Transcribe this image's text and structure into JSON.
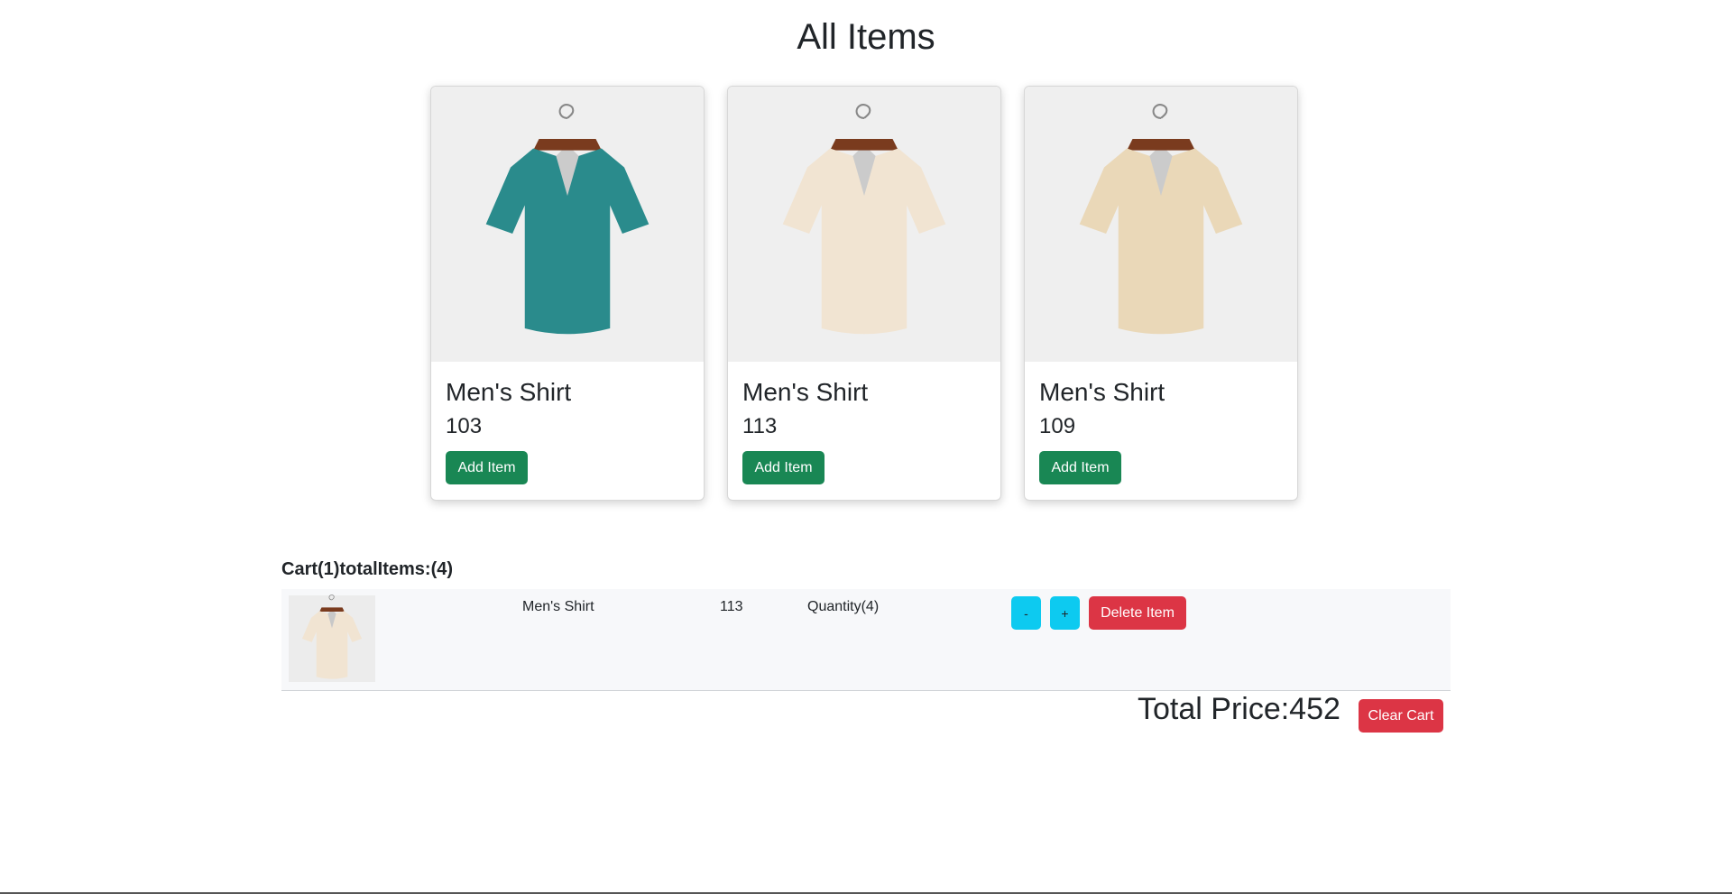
{
  "page": {
    "title": "All Items"
  },
  "products": [
    {
      "name": "Men's Shirt",
      "price": "103",
      "button": "Add Item",
      "pattern": "colorful-abstract"
    },
    {
      "name": "Men's Shirt",
      "price": "113",
      "button": "Add Item",
      "pattern": "green-floral"
    },
    {
      "name": "Men's Shirt",
      "price": "109",
      "button": "Add Item",
      "pattern": "red-floral"
    }
  ],
  "cart": {
    "summary": "Cart(1)totalItems:(4)",
    "items": [
      {
        "name": "Men's Shirt",
        "price": "113",
        "quantity": "Quantity(4)",
        "decrement": "-",
        "increment": "+",
        "delete": "Delete Item"
      }
    ],
    "total": "Total Price:452",
    "clear": "Clear Cart"
  },
  "colors": {
    "success": "#198754",
    "info": "#0dcaf0",
    "danger": "#dc3545"
  }
}
